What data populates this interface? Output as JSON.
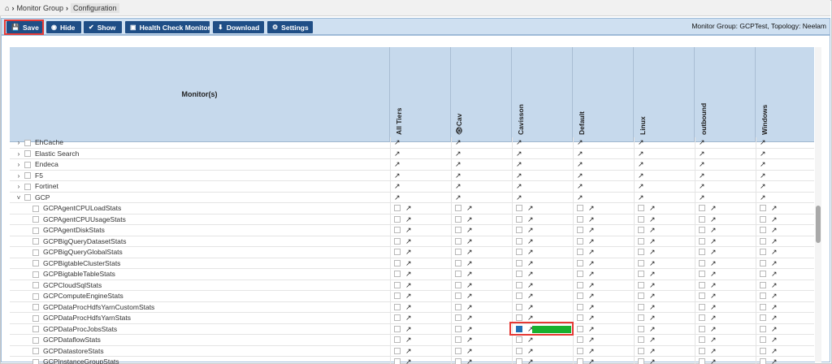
{
  "breadcrumb": {
    "home_icon": "home-icon",
    "items": [
      "Monitor Group",
      "Configuration"
    ]
  },
  "toolbar": {
    "buttons": [
      {
        "label": "Save",
        "icon": "save-icon"
      },
      {
        "label": "Hide",
        "icon": "eye-icon"
      },
      {
        "label": "Show",
        "icon": "check-icon"
      },
      {
        "label": "Health Check Monitor",
        "icon": "monitor-icon"
      },
      {
        "label": "Download",
        "icon": "download-icon"
      },
      {
        "label": "Settings",
        "icon": "gear-icon"
      }
    ],
    "info": "Monitor Group: GCPTest,  Topology: Neelam"
  },
  "grid": {
    "monitor_header": "Monitor(s)",
    "columns": [
      "All Tiers",
      "👁Cav",
      "Cavisson",
      "Default",
      "Linux",
      "outbound",
      "Windows"
    ],
    "categories": [
      {
        "name": "EhCache",
        "expanded": false
      },
      {
        "name": "Elastic Search",
        "expanded": false
      },
      {
        "name": "Endeca",
        "expanded": false
      },
      {
        "name": "F5",
        "expanded": false
      },
      {
        "name": "Fortinet",
        "expanded": false
      },
      {
        "name": "GCP",
        "expanded": true
      }
    ],
    "gcp_items": [
      "GCPAgentCPULoadStats",
      "GCPAgentCPUUsageStats",
      "GCPAgentDiskStats",
      "GCPBigQueryDatasetStats",
      "GCPBigQueryGlobalStats",
      "GCPBigtableClusterStats",
      "GCPBigtableTableStats",
      "GCPCloudSqlStats",
      "GCPComputeEngineStats",
      "GCPDataProcHdfsYarnCustomStats",
      "GCPDataProcHdfsYarnStats",
      "GCPDataProcJobsStats",
      "GCPDataflowStats",
      "GCPDatastoreStats",
      "GCPInstanceGroupStats"
    ],
    "selected_item": "GCPDataProcJobsStats",
    "selected_column": "Cavisson"
  },
  "colors": {
    "button": "#1f4e86",
    "toolbar": "#cfe0f1",
    "header": "#c6d9ec",
    "highlight": "#e53935",
    "progress": "#18b02e"
  }
}
